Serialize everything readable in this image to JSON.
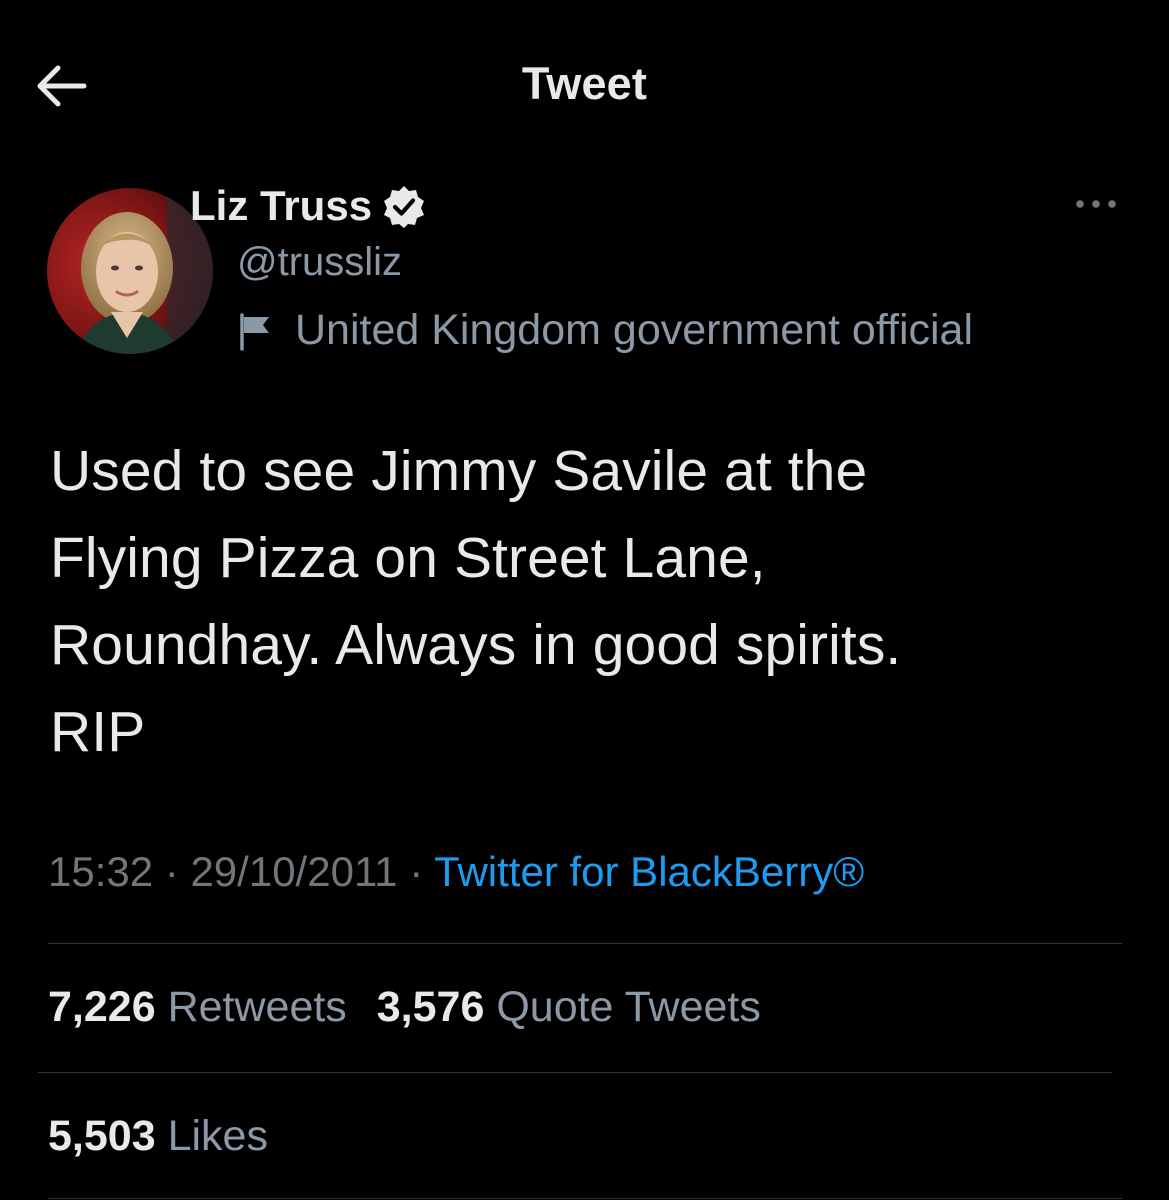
{
  "header": {
    "title": "Tweet",
    "back_icon": "arrow-left-icon"
  },
  "author": {
    "display_name": "Liz Truss",
    "handle": "@trussliz",
    "verified": true,
    "label": "United Kingdom government official",
    "avatar_bg": "#8e1b1b"
  },
  "tweet": {
    "text": "Used to see Jimmy Savile at the\nFlying Pizza on Street Lane,\nRoundhay. Always in good spirits.\nRIP"
  },
  "meta": {
    "time": "15:32",
    "separator": "·",
    "date": "29/10/2011",
    "source": "Twitter for BlackBerry®"
  },
  "stats": {
    "retweets_count": "7,226",
    "retweets_label": "Retweets",
    "quotes_count": "3,576",
    "quotes_label": "Quote Tweets",
    "likes_count": "5,503",
    "likes_label": "Likes"
  },
  "colors": {
    "background": "#000000",
    "text": "#e7e9ea",
    "secondary": "#8b98a5",
    "link": "#1d9bf0",
    "divider": "#2f3336"
  }
}
